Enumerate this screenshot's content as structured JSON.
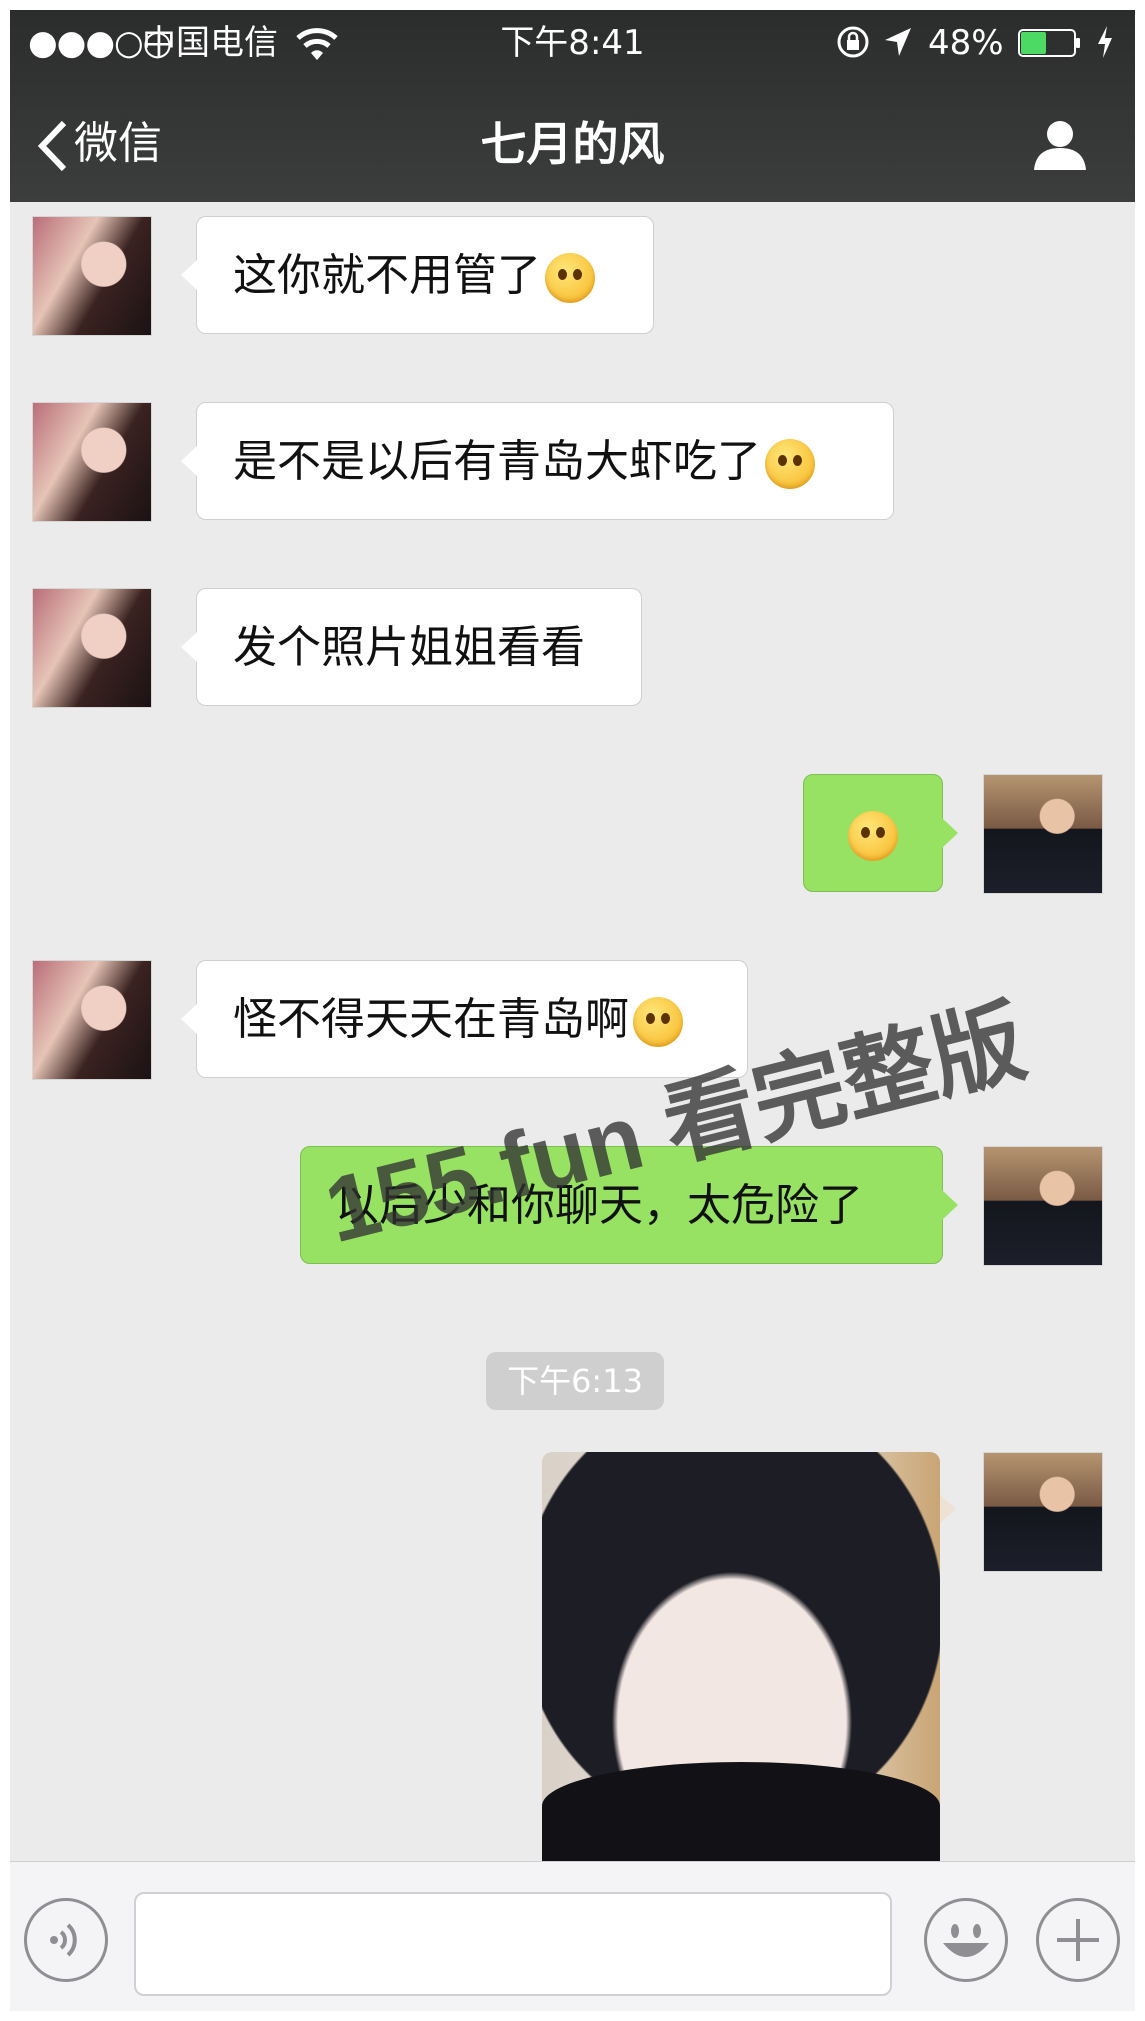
{
  "status_bar": {
    "signal": "●●●○○",
    "carrier": "中国电信",
    "time": "下午8:41",
    "battery_percent": "48%",
    "battery_level": 0.48
  },
  "nav": {
    "back_label": "微信",
    "title": "七月的风"
  },
  "messages": [
    {
      "side": "in",
      "text": "这你就不用管了",
      "emoji": "surprised-emoji"
    },
    {
      "side": "in",
      "text": "是不是以后有青岛大虾吃了",
      "emoji": "heart-eyes-emoji"
    },
    {
      "side": "in",
      "text": "发个照片姐姐看看"
    },
    {
      "side": "out",
      "text": "",
      "emoji": "flushed-emoji"
    },
    {
      "side": "in",
      "text": "怪不得天天在青岛啊",
      "emoji": "grin-emoji"
    },
    {
      "side": "out",
      "text": "以后少和你聊天，太危险了"
    }
  ],
  "time_separator": "下午6:13",
  "watermark": "155.fun 看完整版",
  "colors": {
    "nav_bg": "#333434",
    "chat_bg": "#ebebeb",
    "outgoing_bubble": "#97e163",
    "incoming_bubble": "#ffffff",
    "battery_fill": "#4cd964"
  },
  "input_bar": {
    "voice_icon": "voice-icon",
    "emoji_icon": "emoji-icon",
    "plus_icon": "plus-icon"
  }
}
